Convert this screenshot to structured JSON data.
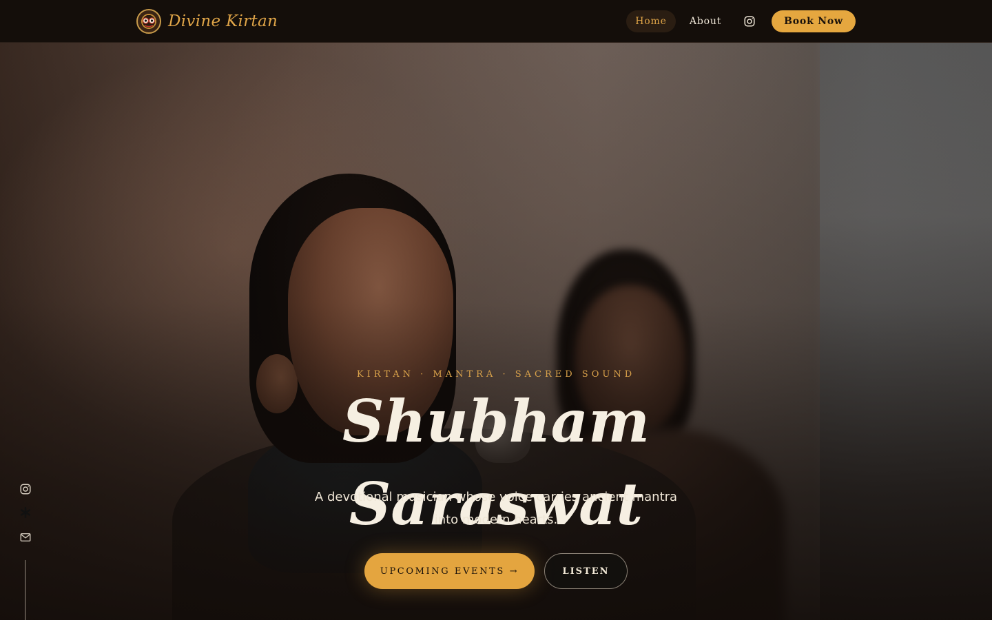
{
  "brand": {
    "name": "Divine Kirtan",
    "logo_icon": "jagannath-face-icon"
  },
  "nav": {
    "home": "Home",
    "about": "About",
    "instagram_icon": "instagram-icon",
    "book_now": "Book Now"
  },
  "hero": {
    "tagline": "KIRTAN  ·  MANTRA  ·  SACRED SOUND",
    "title": "Shubham Saraswat",
    "description": "A devotional musician whose voice carries ancient mantra into modern hearts.",
    "primary_button": "UPCOMING EVENTS →",
    "secondary_button": "LISTEN"
  },
  "side_rail": {
    "icons": [
      "instagram-icon",
      "asterisk-icon",
      "mail-icon"
    ]
  },
  "colors": {
    "accent": "#e4a53f",
    "nav_background": "#140e0a",
    "text_light": "#f6efe2"
  }
}
